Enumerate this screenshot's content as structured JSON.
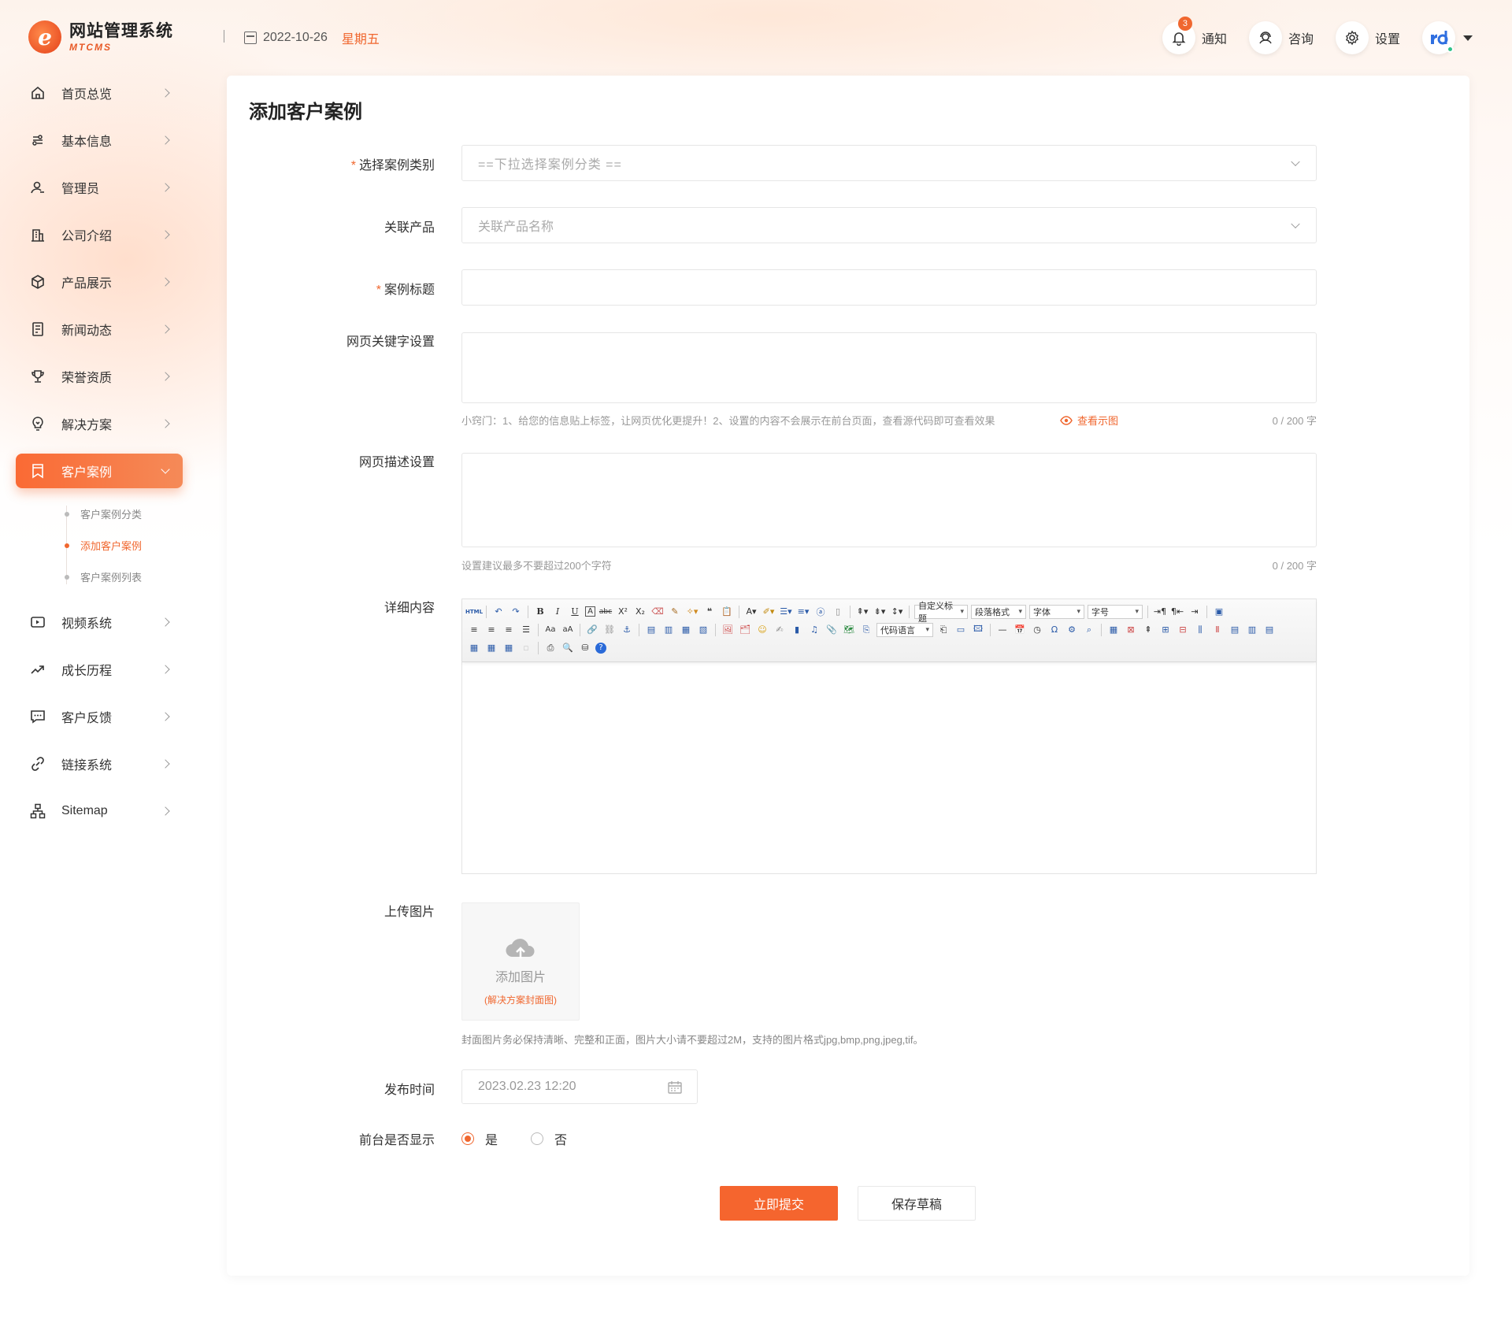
{
  "app": {
    "logo_mark": "e",
    "name": "网站管理系统",
    "sub": "MTCMS"
  },
  "header": {
    "date": "2022-10-26",
    "weekday": "星期五",
    "notify_label": "通知",
    "notify_count": "3",
    "consult_label": "咨询",
    "settings_label": "设置"
  },
  "sidebar": {
    "items": [
      {
        "label": "首页总览",
        "icon": "home-icon"
      },
      {
        "label": "基本信息",
        "icon": "info-icon"
      },
      {
        "label": "管理员",
        "icon": "user-icon"
      },
      {
        "label": "公司介绍",
        "icon": "building-icon"
      },
      {
        "label": "产品展示",
        "icon": "box-icon"
      },
      {
        "label": "新闻动态",
        "icon": "news-icon"
      },
      {
        "label": "荣誉资质",
        "icon": "trophy-icon"
      },
      {
        "label": "解决方案",
        "icon": "bulb-icon"
      },
      {
        "label": "客户案例",
        "icon": "bookmark-icon",
        "active": true
      },
      {
        "label": "视频系统",
        "icon": "video-icon"
      },
      {
        "label": "成长历程",
        "icon": "trend-icon"
      },
      {
        "label": "客户反馈",
        "icon": "chat-icon"
      },
      {
        "label": "链接系统",
        "icon": "link-icon"
      },
      {
        "label": "Sitemap",
        "icon": "sitemap-icon"
      }
    ],
    "sub_items": [
      "客户案例分类",
      "添加客户案例",
      "客户案例列表"
    ]
  },
  "page": {
    "title": "添加客户案例"
  },
  "form": {
    "category": {
      "label": "选择案例类别",
      "placeholder": "==下拉选择案例分类 =="
    },
    "product": {
      "label": "关联产品",
      "placeholder": "关联产品名称"
    },
    "title": {
      "label": "案例标题",
      "value": ""
    },
    "keywords": {
      "label": "网页关键字设置",
      "hint": "小窍门：1、给您的信息贴上标签，让网页优化更提升！2、设置的内容不会展示在前台页面，查看源代码即可查看效果",
      "link": "查看示图",
      "counter": "0 / 200 字"
    },
    "description": {
      "label": "网页描述设置",
      "hint": "设置建议最多不要超过200个字符",
      "counter": "0 / 200 字"
    },
    "content": {
      "label": "详细内容",
      "toolbar_selects": [
        "自定义标题",
        "段落格式",
        "字体",
        "字号",
        "代码语言"
      ]
    },
    "image": {
      "label": "上传图片",
      "button": "添加图片",
      "sub": "(解决方案封面图)",
      "hint": "封面图片务必保持清晰、完整和正面，图片大小请不要超过2M，支持的图片格式jpg,bmp,png,jpeg,tif。"
    },
    "publish_time": {
      "label": "发布时间",
      "value": "2023.02.23 12:20"
    },
    "display": {
      "label": "前台是否显示",
      "yes": "是",
      "no": "否",
      "selected": "是"
    },
    "submit": "立即提交",
    "draft": "保存草稿"
  },
  "colors": {
    "accent": "#f0672f",
    "accent_button": "#f5652e"
  }
}
